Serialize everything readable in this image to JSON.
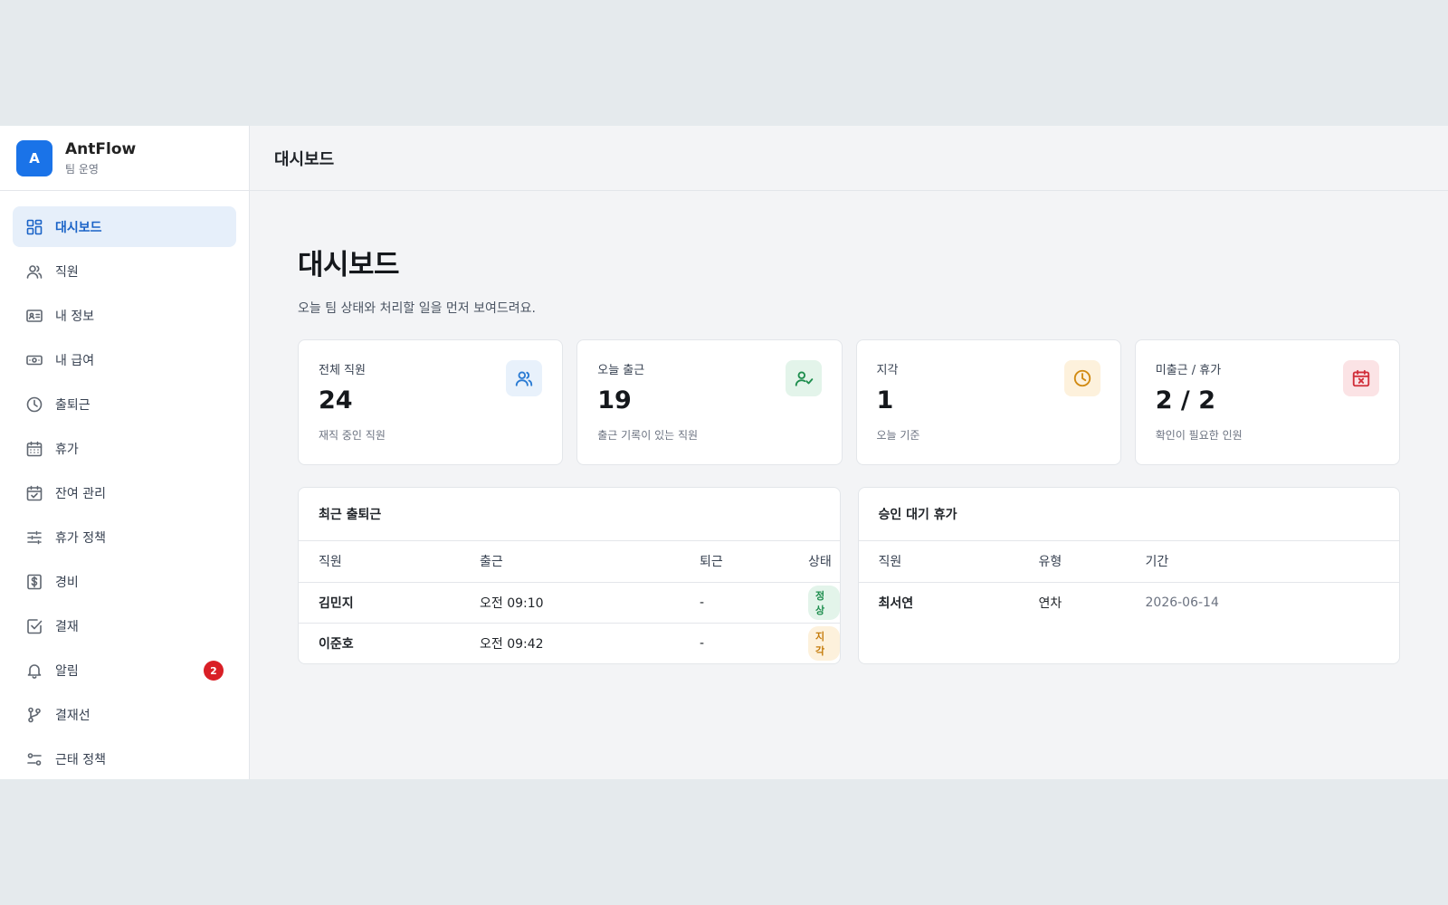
{
  "brand": {
    "logo": "A",
    "name": "AntFlow",
    "sub": "팀 운영"
  },
  "sidebar": {
    "items": [
      {
        "label": "대시보드",
        "icon": "dashboard-icon",
        "active": true
      },
      {
        "label": "직원",
        "icon": "users-icon"
      },
      {
        "label": "내 정보",
        "icon": "id-card-icon"
      },
      {
        "label": "내 급여",
        "icon": "money-icon"
      },
      {
        "label": "출퇴근",
        "icon": "clock-icon"
      },
      {
        "label": "휴가",
        "icon": "calendar-icon"
      },
      {
        "label": "잔여 관리",
        "icon": "calendar-check-icon"
      },
      {
        "label": "휴가 정책",
        "icon": "sliders-icon"
      },
      {
        "label": "경비",
        "icon": "dollar-icon"
      },
      {
        "label": "결재",
        "icon": "check-square-icon"
      },
      {
        "label": "알림",
        "icon": "bell-icon",
        "badge": "2"
      },
      {
        "label": "결재선",
        "icon": "branch-icon"
      },
      {
        "label": "근태 정책",
        "icon": "toggle-icon"
      }
    ]
  },
  "topbar": {
    "title": "대시보드"
  },
  "page": {
    "title": "대시보드",
    "desc": "오늘 팀 상태와 처리할 일을 먼저 보여드려요."
  },
  "cards": [
    {
      "label": "전체 직원",
      "value": "24",
      "sub": "재직 중인 직원",
      "icon": "users-icon",
      "color": "#2a7bd3",
      "bg": "#e8f1fb"
    },
    {
      "label": "오늘 출근",
      "value": "19",
      "sub": "출근 기록이 있는 직원",
      "icon": "user-check-icon",
      "color": "#1e8e4e",
      "bg": "#e3f4ea"
    },
    {
      "label": "지각",
      "value": "1",
      "sub": "오늘 기준",
      "icon": "clock-icon",
      "color": "#d18a12",
      "bg": "#fdf1dc"
    },
    {
      "label": "미출근 / 휴가",
      "value": "2 / 2",
      "sub": "확인이 필요한 인원",
      "icon": "calendar-x-icon",
      "color": "#d12f3a",
      "bg": "#fbe3e5"
    }
  ],
  "recent": {
    "title": "최근 출퇴근",
    "headers": [
      "직원",
      "출근",
      "퇴근",
      "상태"
    ],
    "rows": [
      {
        "name": "김민지",
        "in": "오전 09:10",
        "out": "-",
        "status": "정상",
        "status_type": "ok"
      },
      {
        "name": "이준호",
        "in": "오전 09:42",
        "out": "-",
        "status": "지각",
        "status_type": "late"
      }
    ]
  },
  "pending": {
    "title": "승인 대기 휴가",
    "headers": [
      "직원",
      "유형",
      "기간"
    ],
    "rows": [
      {
        "name": "최서연",
        "type": "연차",
        "period": "2026-06-14"
      }
    ]
  }
}
